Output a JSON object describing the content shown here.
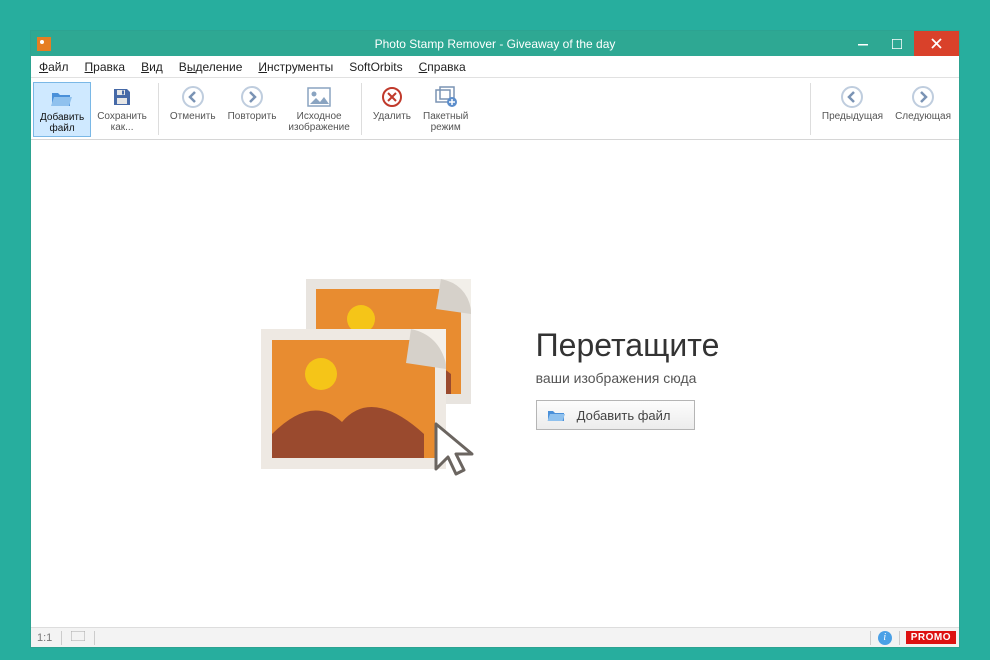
{
  "title": "Photo Stamp Remover - Giveaway of the day",
  "menu": {
    "file": "Файл",
    "edit": "Правка",
    "view": "Вид",
    "select": "Выделение",
    "tools": "Инструменты",
    "softorbits": "SoftOrbits",
    "help": "Справка"
  },
  "toolbar": {
    "addfile_l1": "Добавить",
    "addfile_l2": "файл",
    "saveas_l1": "Сохранить",
    "saveas_l2": "как...",
    "undo": "Отменить",
    "redo": "Повторить",
    "orig_l1": "Исходное",
    "orig_l2": "изображение",
    "delete": "Удалить",
    "batch_l1": "Пакетный",
    "batch_l2": "режим",
    "prev": "Предыдущая",
    "next": "Следующая"
  },
  "drop": {
    "title": "Перетащите",
    "subtitle": "ваши изображения сюда",
    "button": "Добавить файл"
  },
  "status": {
    "zoom": "1:1",
    "promo": "PROMO"
  }
}
